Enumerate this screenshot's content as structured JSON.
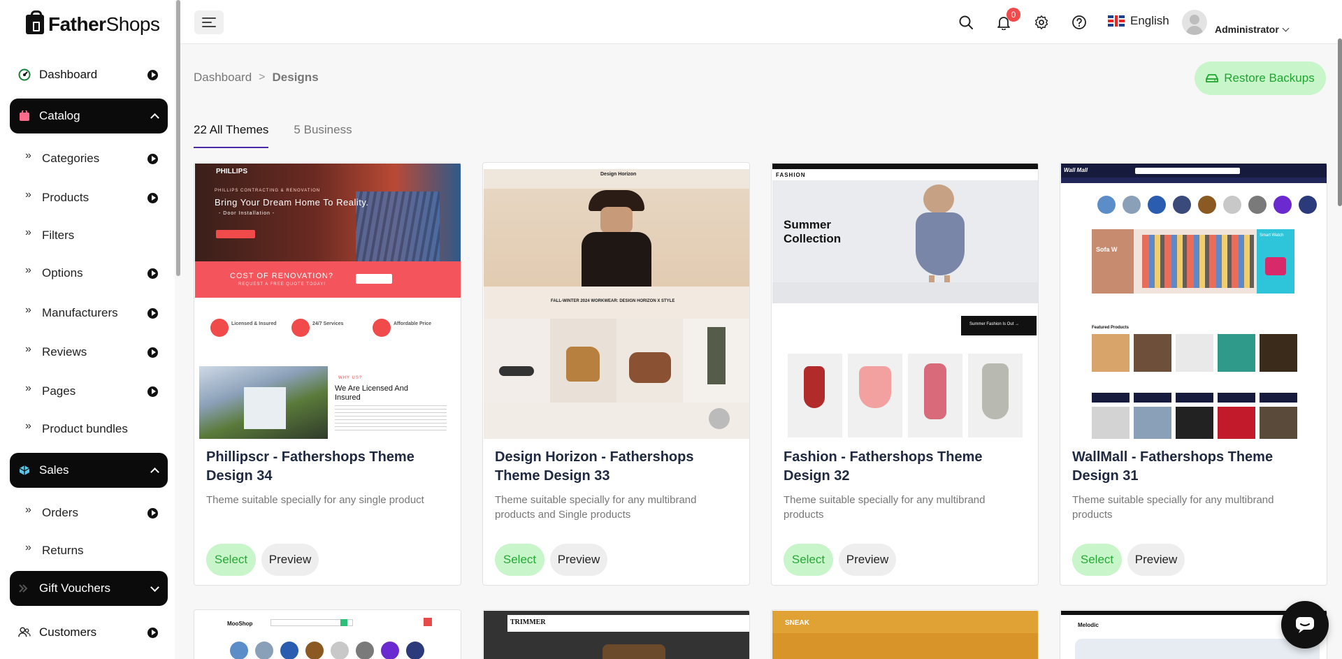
{
  "brand": {
    "bold": "Father",
    "light": "Shops"
  },
  "sidebar": {
    "dashboard": "Dashboard",
    "catalog": "Catalog",
    "catalog_items": [
      "Categories",
      "Products",
      "Filters",
      "Options",
      "Manufacturers",
      "Reviews",
      "Pages",
      "Product bundles"
    ],
    "sales": "Sales",
    "sales_items": [
      "Orders",
      "Returns"
    ],
    "gift_vouchers": "Gift Vouchers",
    "customers": "Customers"
  },
  "header": {
    "notification_count": "0",
    "language": "English",
    "user": "Administrator"
  },
  "breadcrumb": {
    "root": "Dashboard",
    "separator": ">",
    "current": "Designs"
  },
  "restore_label": "Restore Backups",
  "tabs": [
    "22 All Themes",
    "5 Business"
  ],
  "cards": [
    {
      "title": "Phillipscr - Fathershops Theme Design 34",
      "desc": "Theme suitable specially for any single product",
      "select": "Select",
      "preview": "Preview",
      "thumb": {
        "hero_line1": "PHILLIPS CONTRACTING & RENOVATION",
        "hero_line2": "Bring Your Dream Home To Reality.",
        "hero_line3": "- Door Installation -",
        "banner": "COST OF RENOVATION?",
        "banner_sub": "REQUEST A FREE QUOTE TODAY!",
        "feature1": "Licensed & Insured",
        "feature2": "24/7 Services",
        "feature3": "Affordable Price",
        "about_kicker": "WHY US?",
        "about_title": "We Are Licensed And Insured"
      }
    },
    {
      "title": "Design Horizon - Fathershops Theme Design 33",
      "desc": "Theme suitable specially for any multibrand products and Single products",
      "select": "Select",
      "preview": "Preview",
      "thumb": {
        "logo": "Design Horizon",
        "headline": "FALL-WINTER 2024 WORKWEAR: DESIGN HORIZON X STYLE"
      }
    },
    {
      "title": "Fashion - Fathershops Theme Design 32",
      "desc": "Theme suitable specially for any multibrand products",
      "select": "Select",
      "preview": "Preview",
      "thumb": {
        "logo": "FASHION",
        "hero_line1": "Summer",
        "hero_line2": "Collection",
        "cta": "Summer Fashion Is Out →"
      }
    },
    {
      "title": "WallMall - Fathershops Theme Design 31",
      "desc": "Theme suitable specially for any multibrand products",
      "select": "Select",
      "preview": "Preview",
      "thumb": {
        "logo": "Wall Mall",
        "sale": "Sofa W",
        "smart": "Smart Watch",
        "featured": "Featured Products"
      }
    }
  ],
  "row2_logos": [
    "MooShop",
    "TRIMMER",
    "SNEAK",
    "Melodic"
  ],
  "colors": {
    "accent_green": "#27a836",
    "green_bg": "#c9f5cb",
    "tab_underline": "#4b2aa8",
    "dark_nav": "#0b0b0b"
  }
}
